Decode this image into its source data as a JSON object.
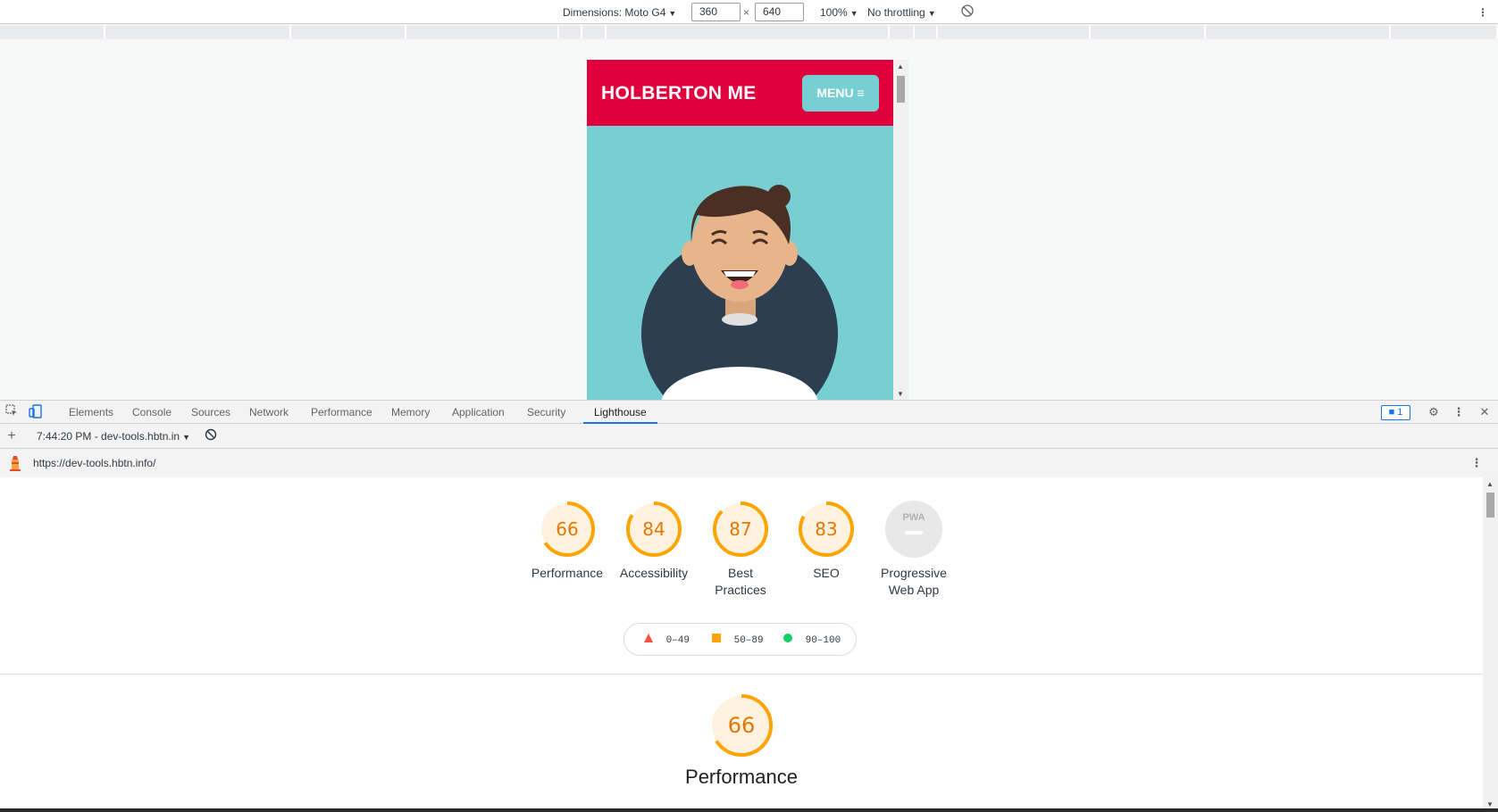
{
  "device_toolbar": {
    "dimensions_label": "Dimensions: Moto G4",
    "width_value": "360",
    "times_sign": "×",
    "height_value": "640",
    "zoom": "100%",
    "throttling": "No throttling",
    "rotate_icon": "rotate-icon",
    "more_icon": "more-vert-icon"
  },
  "site": {
    "title": "HOLBERTON ME",
    "menu_label": "MENU ≡",
    "colors": {
      "header": "#e0003c",
      "hero": "#77cfd3",
      "avatar_bg": "#2d3e50"
    }
  },
  "devtools": {
    "tabs": [
      "Elements",
      "Console",
      "Sources",
      "Network",
      "Performance",
      "Memory",
      "Application",
      "Security",
      "Lighthouse"
    ],
    "active_tab": "Lighthouse",
    "issues_count": "1",
    "inspect_icon": "inspect-element-icon",
    "device_icon": "device-toggle-icon",
    "settings_icon": "gear-icon",
    "close_icon": "close-icon"
  },
  "lighthouse_toolbar": {
    "add_icon": "plus-icon",
    "report_selector": "7:44:20 PM - dev-tools.hbtn.in",
    "clear_icon": "block-icon"
  },
  "url_bar": {
    "url": "https://dev-tools.hbtn.info/",
    "lighthouse_icon": "lighthouse-icon"
  },
  "report": {
    "gauges": [
      {
        "score": "66",
        "value": 66,
        "label_line1": "Performance",
        "label_line2": ""
      },
      {
        "score": "84",
        "value": 84,
        "label_line1": "Accessibility",
        "label_line2": ""
      },
      {
        "score": "87",
        "value": 87,
        "label_line1": "Best",
        "label_line2": "Practices"
      },
      {
        "score": "83",
        "value": 83,
        "label_line1": "SEO",
        "label_line2": ""
      }
    ],
    "pwa": {
      "badge_text": "PWA",
      "label_line1": "Progressive",
      "label_line2": "Web App"
    },
    "legend": [
      {
        "icon": "triangle-icon",
        "range": "0–49",
        "color": "#ff4e42"
      },
      {
        "icon": "square-icon",
        "range": "50–89",
        "color": "#ffa400"
      },
      {
        "icon": "circle-icon",
        "range": "90–100",
        "color": "#0cce6b"
      }
    ],
    "performance_section": {
      "score": "66",
      "value": 66,
      "title": "Performance"
    },
    "colors": {
      "average": "#ffa400",
      "average_text": "#c33300",
      "average_bg": "#fff3e0"
    }
  }
}
